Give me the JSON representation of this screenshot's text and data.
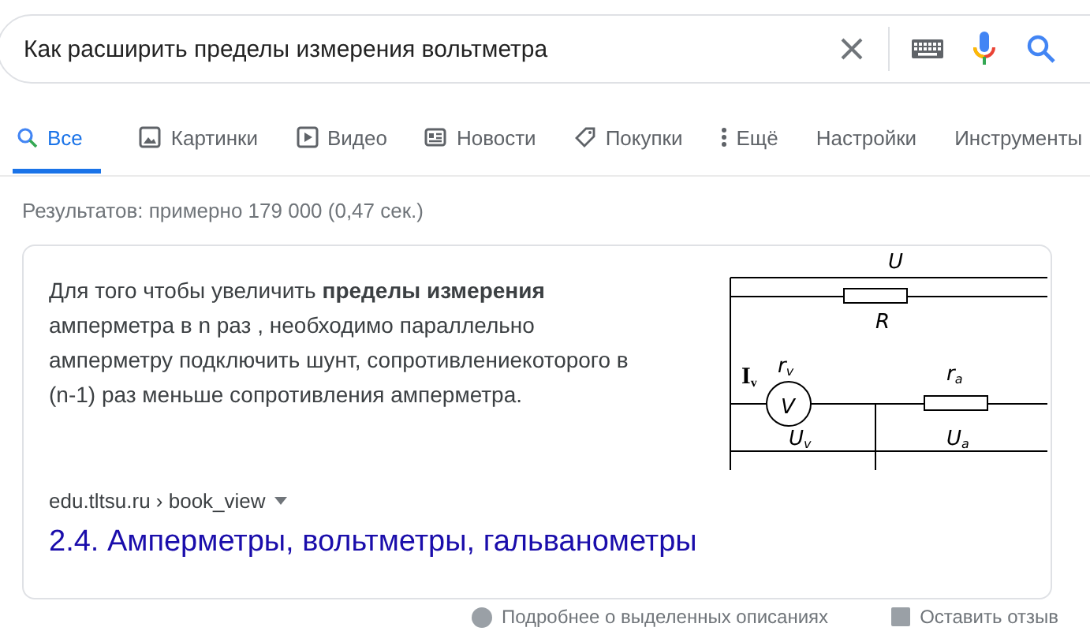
{
  "search": {
    "value": "Как расширить пределы измерения вольтметра"
  },
  "tabs": [
    {
      "label": "Все",
      "selected": true
    },
    {
      "label": "Картинки",
      "selected": false
    },
    {
      "label": "Видео",
      "selected": false
    },
    {
      "label": "Новости",
      "selected": false
    },
    {
      "label": "Покупки",
      "selected": false
    },
    {
      "label": "Ещё",
      "selected": false
    }
  ],
  "tools": [
    "Настройки",
    "Инструменты"
  ],
  "result_stats": "Результатов: примерно 179 000 (0,47 сек.)",
  "snippet": {
    "text": "Для того чтобы увеличить **пределы измерения** амперметра в n раз , необходимо параллельно амперметру подключить шунт, сопротивлениекоторого в (n-1) раз меньше сопротивления амперметра.",
    "diagram_labels": [
      "U",
      "R",
      "I",
      "v",
      "r",
      "v",
      "V",
      "r",
      "a",
      "U",
      "v",
      "U",
      "a"
    ],
    "source": "edu.tltsu.ru › book_view",
    "title": "2.4. Амперметры, вольтметры, гальванометры"
  },
  "footer": [
    "Подробнее о выделенных описаниях",
    "Оставить отзыв"
  ]
}
